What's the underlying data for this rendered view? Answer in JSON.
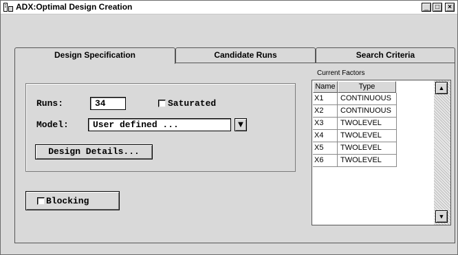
{
  "window": {
    "title": "ADX:Optimal Design Creation",
    "minimize_glyph": "_",
    "maximize_glyph": "□",
    "close_glyph": "×"
  },
  "tabs": [
    {
      "label": "Design Specification",
      "selected": true
    },
    {
      "label": "Candidate Runs",
      "selected": false
    },
    {
      "label": "Search Criteria",
      "selected": false
    }
  ],
  "form": {
    "runs_label": "Runs:",
    "runs_value": "34",
    "saturated_label": "Saturated",
    "saturated_checked": false,
    "model_label": "Model:",
    "model_value": "User defined ...",
    "dropdown_glyph": "▼",
    "design_details_button": "Design Details...",
    "blocking_label": "Blocking",
    "blocking_checked": false
  },
  "factors": {
    "title": "Current Factors",
    "columns": [
      "Name",
      "Type"
    ],
    "rows": [
      {
        "name": "X1",
        "type": "CONTINUOUS"
      },
      {
        "name": "X2",
        "type": "CONTINUOUS"
      },
      {
        "name": "X3",
        "type": "TWOLEVEL"
      },
      {
        "name": "X4",
        "type": "TWOLEVEL"
      },
      {
        "name": "X5",
        "type": "TWOLEVEL"
      },
      {
        "name": "X6",
        "type": "TWOLEVEL"
      }
    ],
    "scroll_up_glyph": "▲",
    "scroll_down_glyph": "▼"
  }
}
